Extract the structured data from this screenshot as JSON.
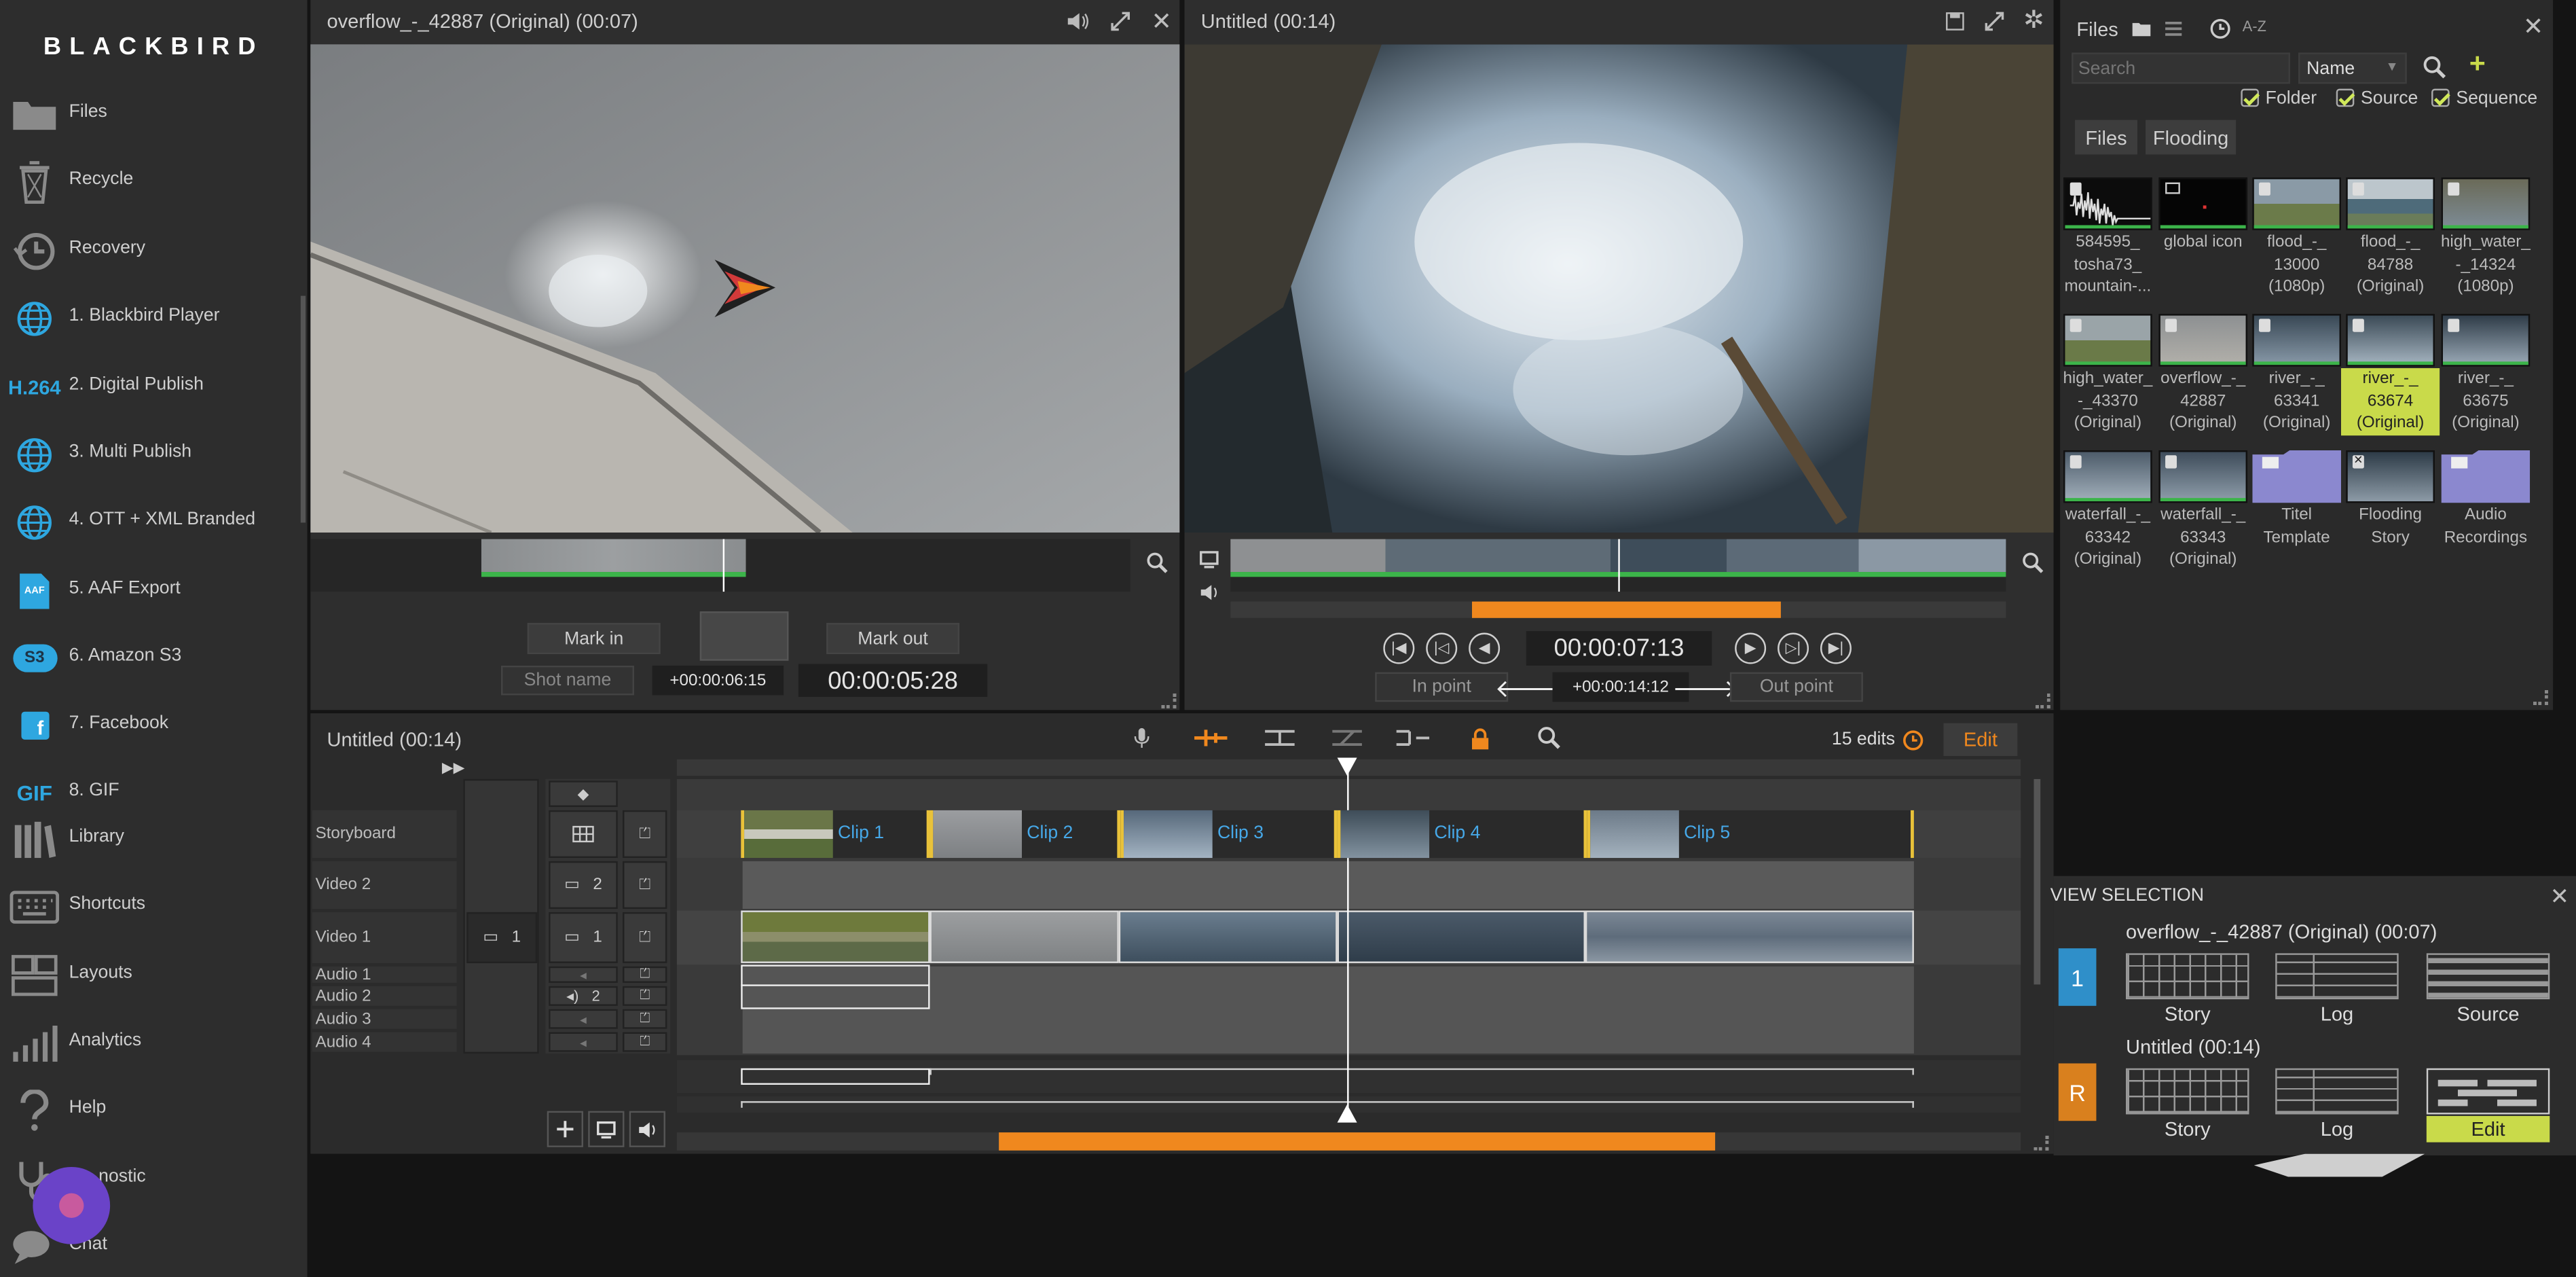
{
  "app": {
    "name": "BLACKBIRD"
  },
  "sidebar": {
    "items": [
      {
        "label": "Files",
        "icon": "folder-icon"
      },
      {
        "label": "Recycle",
        "icon": "recycle-bin-icon"
      },
      {
        "label": "Recovery",
        "icon": "history-icon"
      },
      {
        "label": "1. Blackbird Player",
        "icon": "globe-icon"
      },
      {
        "label": "2. Digital Publish",
        "icon": "h264-icon",
        "icon_text": "H.264"
      },
      {
        "label": "3. Multi Publish",
        "icon": "globe-icon"
      },
      {
        "label": "4. OTT + XML Branded",
        "icon": "globe-icon"
      },
      {
        "label": "5. AAF Export",
        "icon": "aaf-file-icon",
        "icon_text": "AAF"
      },
      {
        "label": "6. Amazon S3",
        "icon": "s3-icon",
        "icon_text": "S3"
      },
      {
        "label": "7. Facebook",
        "icon": "facebook-icon",
        "icon_text": "f"
      },
      {
        "label": "8. GIF",
        "icon": "gif-icon",
        "icon_text": "GIF"
      },
      {
        "label": "Library",
        "icon": "library-icon"
      },
      {
        "label": "Shortcuts",
        "icon": "keyboard-icon"
      },
      {
        "label": "Layouts",
        "icon": "layout-icon"
      },
      {
        "label": "Analytics",
        "icon": "bar-chart-icon"
      },
      {
        "label": "Help",
        "icon": "question-icon"
      },
      {
        "label": "Diagnostic",
        "icon": "stethoscope-icon",
        "display": "nostic"
      },
      {
        "label": "Chat",
        "icon": "chat-icon"
      }
    ]
  },
  "source_viewer": {
    "title": "overflow_-_42887 (Original) (00:07)",
    "mark_in": "Mark in",
    "mark_out": "Mark out",
    "shot_name": "Shot name",
    "offset": "+00:00:06:15",
    "timecode": "00:00:05:28"
  },
  "program_viewer": {
    "title": "Untitled (00:14)",
    "timecode": "00:00:07:13",
    "in_point": "In point",
    "out_point": "Out point",
    "offset": "+00:00:14:12"
  },
  "files": {
    "title": "Files",
    "sort_label": "A-Z",
    "search_placeholder": "Search",
    "sort_select": "Name",
    "filters": [
      "Folder",
      "Source",
      "Sequence"
    ],
    "tabs": [
      "Files",
      "Flooding"
    ],
    "items": [
      {
        "label": "584595_\ntosha73_\nmountain-..."
      },
      {
        "label": "global icon"
      },
      {
        "label": "flood_-_\n13000\n(1080p)"
      },
      {
        "label": "flood_-_\n84788\n(Original)"
      },
      {
        "label": "high_water_\n-_14324\n(1080p)"
      },
      {
        "label": "high_water_\n-_43370\n(Original)"
      },
      {
        "label": "overflow_-_\n42887\n(Original)"
      },
      {
        "label": "river_-_\n63341\n(Original)"
      },
      {
        "label": "river_-_\n63674\n(Original)",
        "selected": true
      },
      {
        "label": "river_-_\n63675\n(Original)"
      },
      {
        "label": "waterfall_-_\n63342\n(Original)"
      },
      {
        "label": "waterfall_-_\n63343\n(Original)"
      },
      {
        "label": "Titel\nTemplate"
      },
      {
        "label": "Flooding\nStory"
      },
      {
        "label": "Audio\nRecordings"
      }
    ]
  },
  "timeline": {
    "title": "Untitled (00:14)",
    "edits": "15 edits",
    "edit_button": "Edit",
    "tracks": [
      "Storyboard",
      "Video 2",
      "Video 1",
      "Audio 1",
      "Audio 2",
      "Audio 3",
      "Audio 4"
    ],
    "route_video1": "1",
    "route_video2": "2",
    "route_video1b": "1",
    "route_audio2": "2",
    "clips": [
      "Clip 1",
      "Clip 2",
      "Clip 3",
      "Clip 4",
      "Clip 5"
    ]
  },
  "view_selection": {
    "title": "VIEW SELECTION",
    "row1": {
      "badge": "1",
      "title": "overflow_-_42887 (Original) (00:07)",
      "options": [
        "Story",
        "Log",
        "Source"
      ]
    },
    "row2": {
      "badge": "R",
      "title": "Untitled (00:14)",
      "options": [
        "Story",
        "Log",
        "Edit"
      ]
    }
  },
  "colors": {
    "accent": "#f0881e",
    "green": "#3cb44a",
    "blue": "#46a8e8",
    "highlight": "#c9da4a"
  }
}
